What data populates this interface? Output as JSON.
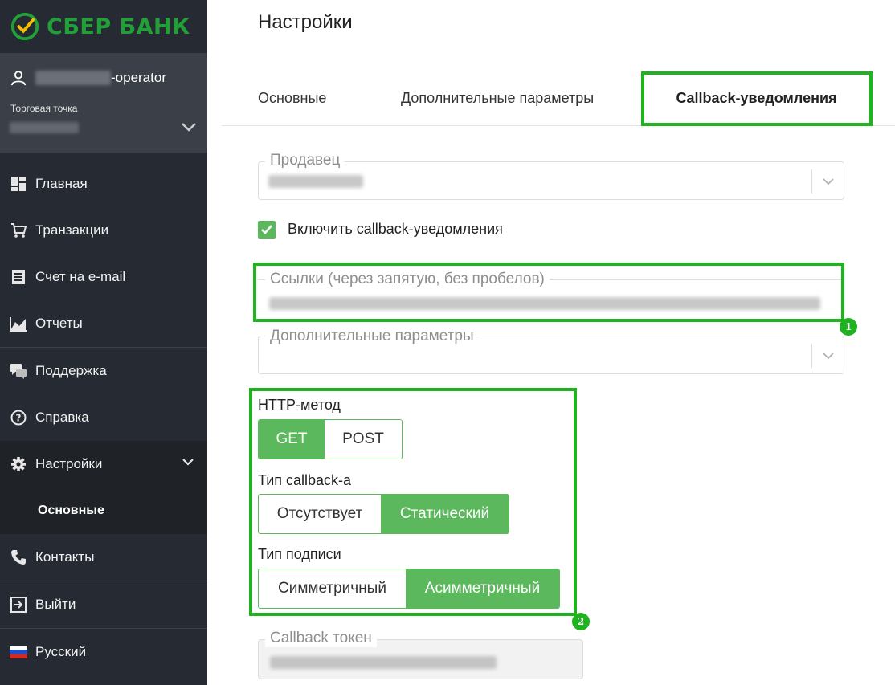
{
  "brand": {
    "name": "СБЕР БАНК",
    "color": "#21a038"
  },
  "user": {
    "name_suffix": "-operator",
    "store_label": "Торговая точка"
  },
  "nav": {
    "items": [
      {
        "label": "Главная",
        "icon": "dashboard-icon"
      },
      {
        "label": "Транзакции",
        "icon": "cart-icon"
      },
      {
        "label": "Счет на e-mail",
        "icon": "list-icon"
      },
      {
        "label": "Отчеты",
        "icon": "chart-icon"
      },
      {
        "label": "Поддержка",
        "icon": "chat-icon"
      },
      {
        "label": "Справка",
        "icon": "help-icon"
      },
      {
        "label": "Настройки",
        "icon": "gear-icon"
      },
      {
        "label": "Контакты",
        "icon": "phone-icon"
      },
      {
        "label": "Выйти",
        "icon": "logout-icon"
      },
      {
        "label": "Русский",
        "icon": "russia-flag-icon"
      }
    ],
    "sub_item": "Основные"
  },
  "page": {
    "title": "Настройки"
  },
  "tabs": [
    {
      "label": "Основные"
    },
    {
      "label": "Дополнительные параметры"
    },
    {
      "label": "Callback-уведомления",
      "active": true
    }
  ],
  "form": {
    "seller_label": "Продавец",
    "enable_callbacks_label": "Включить callback-уведомления",
    "enable_callbacks_checked": true,
    "links_label": "Ссылки (через запятую, без пробелов)",
    "extra_params_label": "Дополнительные параметры",
    "http_method": {
      "label": "HTTP-метод",
      "options": [
        "GET",
        "POST"
      ],
      "selected": "GET"
    },
    "callback_type": {
      "label": "Тип callback-а",
      "options": [
        "Отсутствует",
        "Статический"
      ],
      "selected": "Статический"
    },
    "signature_type": {
      "label": "Тип подписи",
      "options": [
        "Симметричный",
        "Асимметричный"
      ],
      "selected": "Асимметричный"
    },
    "token_label": "Callback токен"
  },
  "annotations": {
    "badge1": "1",
    "badge2": "2",
    "highlight_color": "#1fb31f"
  },
  "colors": {
    "accent": "#5cb85c",
    "sidebar": "#262b33",
    "sidebar_user": "#3a3f48"
  }
}
